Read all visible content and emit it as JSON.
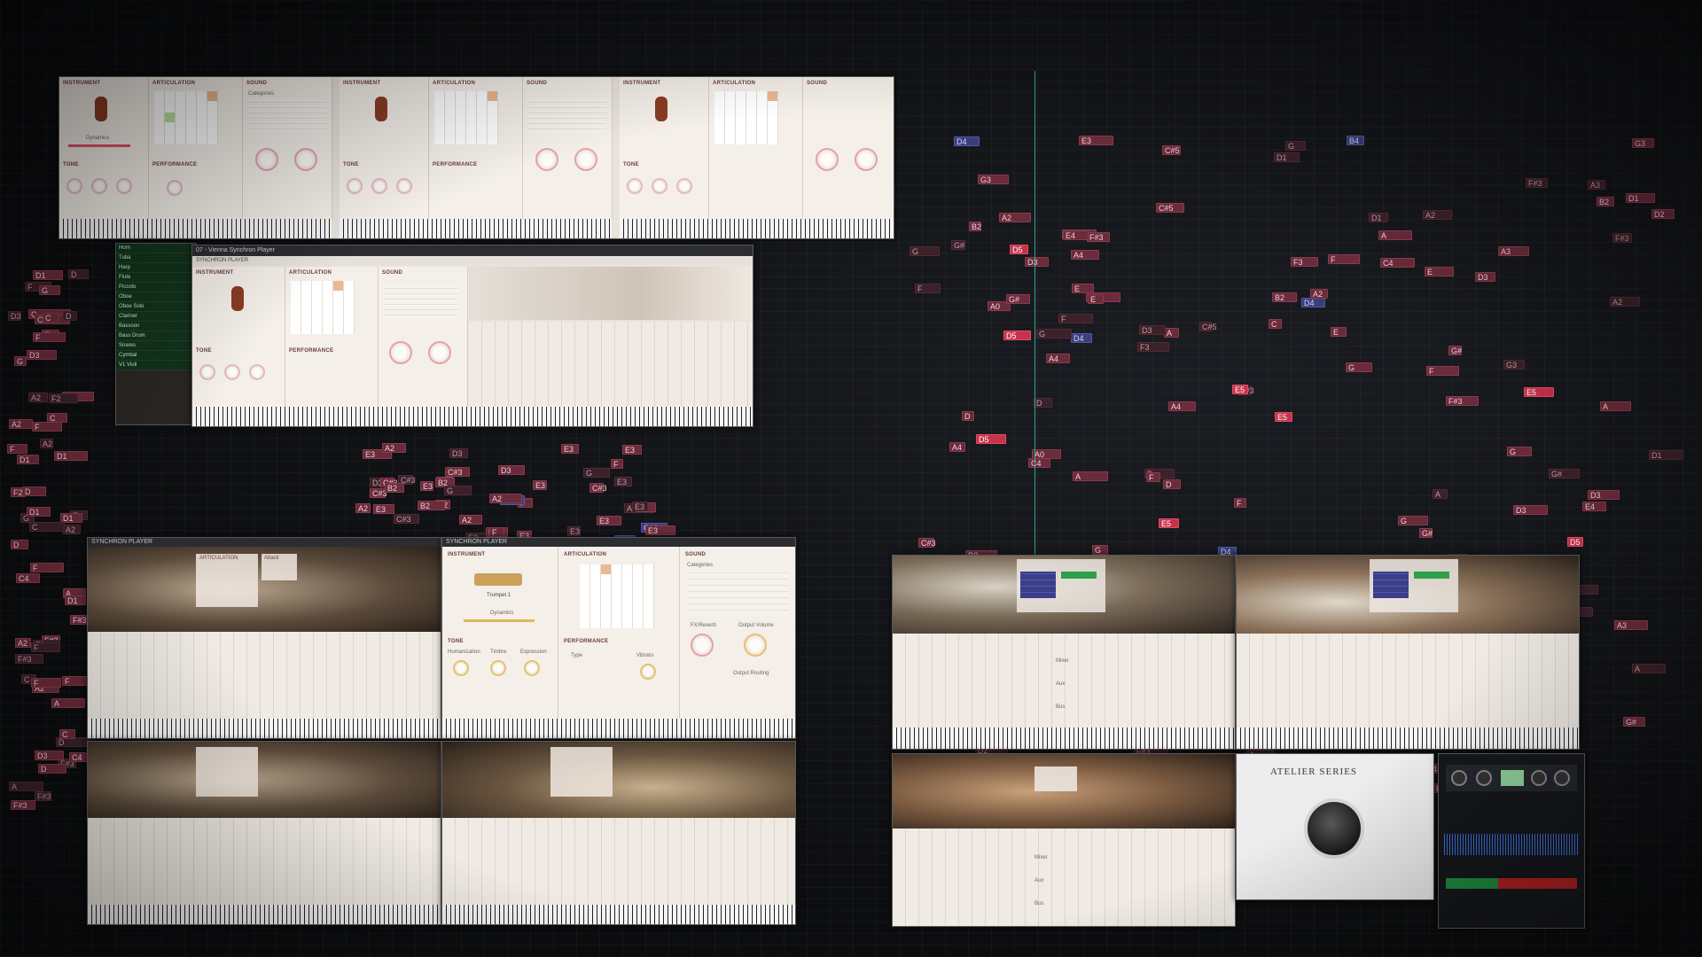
{
  "player_title": "SYNCHRON PLAYER",
  "window_title": "07 - Vienna Synchron Player",
  "vienna_title": "Vienna Synchron Player",
  "sections": {
    "instrument": "INSTRUMENT",
    "articulation": "ARTICULATION",
    "sound": "SOUND",
    "tone": "TONE",
    "performance": "PERFORMANCE",
    "attack": "Attack",
    "categories": "Categories",
    "dynamics": "Dynamics",
    "humanization": "Humanization",
    "timbre": "Timbre",
    "expression": "Expression",
    "fx_reverb": "FX/Reverb",
    "output_volume": "Output Volume",
    "output_routing": "Output Routing",
    "type": "Type",
    "vibrato": "Vibrato",
    "mixer": "Mixer",
    "aux": "Aux",
    "bus": "Bus"
  },
  "instrument_name": "Trumpet 1",
  "tracks": [
    "Horn",
    "Tuba",
    "Harp",
    "Flute",
    "Piccolo",
    "Oboe",
    "Oboe Solo",
    "Clarinet",
    "Bassoon",
    "Bass Drum",
    "Snares",
    "Cymbal",
    "V1 Violi"
  ],
  "atelier": {
    "label": "ATELIER SERIES"
  },
  "notes": {
    "left": [
      {
        "t": "F",
        "c": ""
      },
      {
        "t": "F",
        "c": ""
      },
      {
        "t": "F",
        "c": ""
      },
      {
        "t": "D",
        "c": ""
      },
      {
        "t": "C4",
        "c": ""
      },
      {
        "t": "A",
        "c": ""
      },
      {
        "t": "F#3",
        "c": ""
      },
      {
        "t": "F#3",
        "c": ""
      },
      {
        "t": "F",
        "c": ""
      },
      {
        "t": "D3",
        "c": ""
      },
      {
        "t": "C",
        "c": ""
      },
      {
        "t": "A2",
        "c": ""
      },
      {
        "t": "A2",
        "c": ""
      },
      {
        "t": "G",
        "c": ""
      },
      {
        "t": "F2",
        "c": ""
      },
      {
        "t": "D1",
        "c": ""
      },
      {
        "t": "D1",
        "c": ""
      },
      {
        "t": "C",
        "c": ""
      },
      {
        "t": "D",
        "c": ""
      }
    ],
    "mid": [
      {
        "t": "E3",
        "c": ""
      },
      {
        "t": "E3",
        "c": ""
      },
      {
        "t": "E3",
        "c": ""
      },
      {
        "t": "E3",
        "c": ""
      },
      {
        "t": "E3",
        "c": ""
      },
      {
        "t": "D3",
        "c": ""
      },
      {
        "t": "C#3",
        "c": "blue"
      },
      {
        "t": "C#3",
        "c": ""
      },
      {
        "t": "C#3",
        "c": ""
      },
      {
        "t": "B2",
        "c": ""
      },
      {
        "t": "A2",
        "c": ""
      },
      {
        "t": "A2",
        "c": ""
      },
      {
        "t": "G",
        "c": ""
      },
      {
        "t": "F",
        "c": ""
      }
    ],
    "right": [
      {
        "t": "E5",
        "c": "hot"
      },
      {
        "t": "E",
        "c": ""
      },
      {
        "t": "D5",
        "c": "hot"
      },
      {
        "t": "C#5",
        "c": ""
      },
      {
        "t": "G#",
        "c": ""
      },
      {
        "t": "F",
        "c": ""
      },
      {
        "t": "A",
        "c": ""
      },
      {
        "t": "A",
        "c": ""
      },
      {
        "t": "D4",
        "c": "blue"
      },
      {
        "t": "C4",
        "c": ""
      },
      {
        "t": "A3",
        "c": ""
      },
      {
        "t": "G",
        "c": ""
      },
      {
        "t": "F#3",
        "c": ""
      },
      {
        "t": "E3",
        "c": ""
      },
      {
        "t": "D3",
        "c": ""
      },
      {
        "t": "C",
        "c": ""
      },
      {
        "t": "B2",
        "c": ""
      },
      {
        "t": "A2",
        "c": ""
      },
      {
        "t": "G",
        "c": ""
      },
      {
        "t": "F",
        "c": ""
      },
      {
        "t": "A0",
        "c": ""
      },
      {
        "t": "D1",
        "c": ""
      },
      {
        "t": "E4",
        "c": ""
      },
      {
        "t": "A",
        "c": ""
      },
      {
        "t": "D",
        "c": ""
      },
      {
        "t": "B4",
        "c": "blue"
      },
      {
        "t": "A4",
        "c": ""
      },
      {
        "t": "G3",
        "c": ""
      },
      {
        "t": "F#3",
        "c": ""
      },
      {
        "t": "F3",
        "c": ""
      },
      {
        "t": "D3",
        "c": ""
      },
      {
        "t": "C#3",
        "c": ""
      },
      {
        "t": "A2",
        "c": ""
      },
      {
        "t": "G#",
        "c": ""
      },
      {
        "t": "D2",
        "c": ""
      }
    ]
  }
}
